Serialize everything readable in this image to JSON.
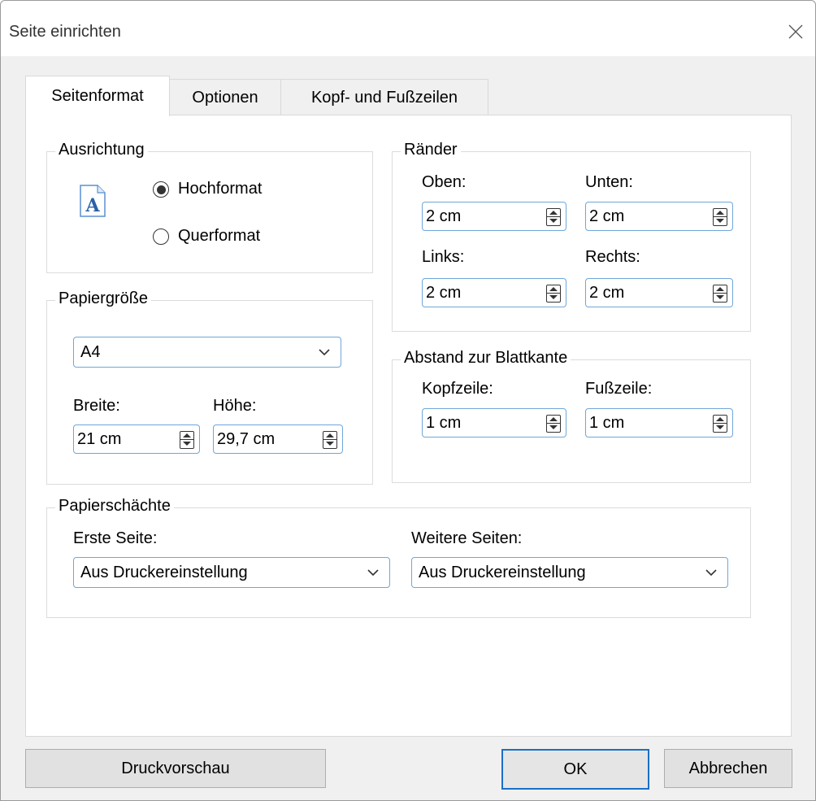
{
  "window": {
    "title": "Seite einrichten"
  },
  "tabs": [
    {
      "label": "Seitenformat",
      "active": true
    },
    {
      "label": "Optionen",
      "active": false
    },
    {
      "label": "Kopf- und Fußzeilen",
      "active": false
    }
  ],
  "orientation": {
    "title": "Ausrichtung",
    "icon": "page-portrait-icon",
    "icon_letter": "A",
    "options": [
      {
        "label": "Hochformat",
        "selected": true
      },
      {
        "label": "Querformat",
        "selected": false
      }
    ]
  },
  "margins": {
    "title": "Ränder",
    "top_label": "Oben:",
    "top_value": "2 cm",
    "bottom_label": "Unten:",
    "bottom_value": "2 cm",
    "left_label": "Links:",
    "left_value": "2 cm",
    "right_label": "Rechts:",
    "right_value": "2 cm"
  },
  "paper_size": {
    "title": "Papiergröße",
    "selected": "A4",
    "width_label": "Breite:",
    "width_value": "21 cm",
    "height_label": "Höhe:",
    "height_value": "29,7 cm"
  },
  "edge_distance": {
    "title": "Abstand zur Blattkante",
    "header_label": "Kopfzeile:",
    "header_value": "1 cm",
    "footer_label": "Fußzeile:",
    "footer_value": "1 cm"
  },
  "paper_trays": {
    "title": "Papierschächte",
    "first_page_label": "Erste Seite:",
    "first_page_value": "Aus Druckereinstellung",
    "other_pages_label": "Weitere Seiten:",
    "other_pages_value": "Aus Druckereinstellung"
  },
  "buttons": {
    "preview": "Druckvorschau",
    "ok": "OK",
    "cancel": "Abbrechen"
  },
  "colors": {
    "accent": "#1a6fc9",
    "field_border": "#6fa7d9",
    "icon_blue": "#2b5fa8"
  }
}
